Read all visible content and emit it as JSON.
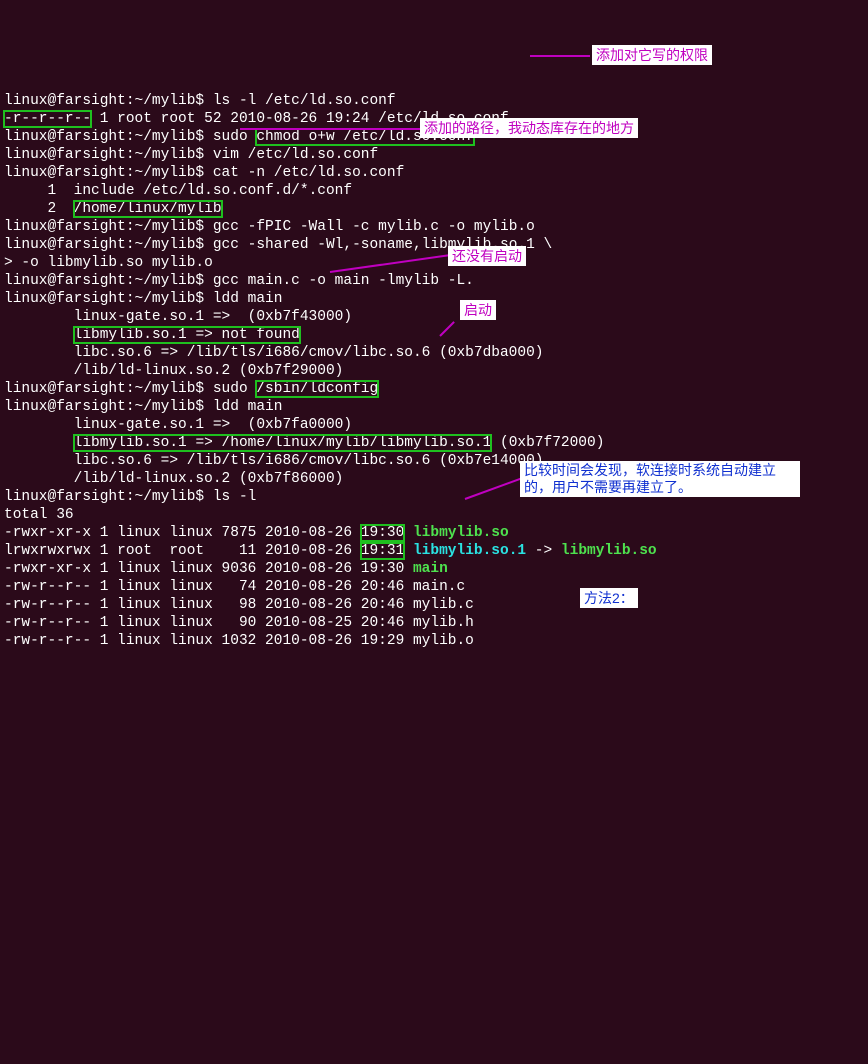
{
  "prompt": "linux@farsight:~/mylib$",
  "cont": ">",
  "cmds": {
    "ls_etc": "ls -l /etc/ld.so.conf",
    "chmod": "sudo ",
    "chmod_boxed": "chmod o+w /etc/ld.so.conf",
    "vim": "vim /etc/ld.so.conf",
    "cat": "cat -n /etc/ld.so.conf",
    "gcc1": "gcc -fPIC -Wall -c mylib.c -o mylib.o",
    "gcc2": "gcc -shared -Wl,-soname,libmylib.so.1 \\",
    "gcc2b": "-o libmylib.so mylib.o",
    "gcc3": "gcc main.c -o main -lmylib -L.",
    "ldd1": "ldd main",
    "ldconfig_pre": "sudo ",
    "ldconfig_box": "/sbin/ldconfig",
    "lsl": "ls -l"
  },
  "out": {
    "ls_etc": {
      "perm_box": "-r--r--r--",
      "rest": " 1 root root 52 2010-08-26 19:24 /etc/ld.so.conf"
    },
    "cat_l1_pre": "     1\t",
    "cat_l1_txt": "include /etc/ld.so.conf.d/*.conf",
    "cat_l2_pre": "     2\t",
    "cat_l2_box": "/home/linux/mylib",
    "ldd_a1": "        linux-gate.so.1 =>  (0xb7f43000)",
    "ldd_a2_box": "libmylib.so.1 => not found",
    "ldd_a3": "        libc.so.6 => /lib/tls/i686/cmov/libc.so.6 (0xb7dba000)",
    "ldd_a4": "        /lib/ld-linux.so.2 (0xb7f29000)",
    "ldd_b1": "        linux-gate.so.1 =>  (0xb7fa0000)",
    "ldd_b2_box": "libmylib.so.1 => /home/linux/mylib/libmylib.so.1",
    "ldd_b2_suf": " (0xb7f72000)",
    "ldd_b3": "        libc.so.6 => /lib/tls/i686/cmov/libc.so.6 (0xb7e14000)",
    "ldd_b4": "        /lib/ld-linux.so.2 (0xb7f86000)",
    "total": "total 36",
    "ls": [
      {
        "perm": "-rwxr-xr-x",
        "n": "1",
        "usr": "linux",
        "grp": "linux",
        "sz": "7875",
        "date": "2010-08-26",
        "tm": "19:30",
        "name": "libmylib.so",
        "color": "grn",
        "boxtm": true
      },
      {
        "perm": "lrwxrwxrwx",
        "n": "1",
        "usr": "root ",
        "grp": "root ",
        "sz": "  11",
        "date": "2010-08-26",
        "tm": "19:31",
        "name": "libmylib.so.1",
        "color": "cyn",
        "boxtm": true,
        "link": " -> ",
        "tgt": "libmylib.so",
        "tgtcolor": "grn"
      },
      {
        "perm": "-rwxr-xr-x",
        "n": "1",
        "usr": "linux",
        "grp": "linux",
        "sz": "9036",
        "date": "2010-08-26",
        "tm": "19:30",
        "name": "main",
        "color": "grn"
      },
      {
        "perm": "-rw-r--r--",
        "n": "1",
        "usr": "linux",
        "grp": "linux",
        "sz": "  74",
        "date": "2010-08-26",
        "tm": "20:46",
        "name": "main.c"
      },
      {
        "perm": "-rw-r--r--",
        "n": "1",
        "usr": "linux",
        "grp": "linux",
        "sz": "  98",
        "date": "2010-08-26",
        "tm": "20:46",
        "name": "mylib.c"
      },
      {
        "perm": "-rw-r--r--",
        "n": "1",
        "usr": "linux",
        "grp": "linux",
        "sz": "  90",
        "date": "2010-08-25",
        "tm": "20:46",
        "name": "mylib.h"
      },
      {
        "perm": "-rw-r--r--",
        "n": "1",
        "usr": "linux",
        "grp": "linux",
        "sz": "1032",
        "date": "2010-08-26",
        "tm": "19:29",
        "name": "mylib.o"
      }
    ]
  },
  "ann": {
    "a1": "添加对它写的权限",
    "a2": "添加的路径，我动态库存在的地方",
    "a3": "还没有启动",
    "a4": "启动",
    "a5": "比较时间会发现，软连接时系统自动建立的，用户不需要再建立了。",
    "a6": "方法2："
  }
}
